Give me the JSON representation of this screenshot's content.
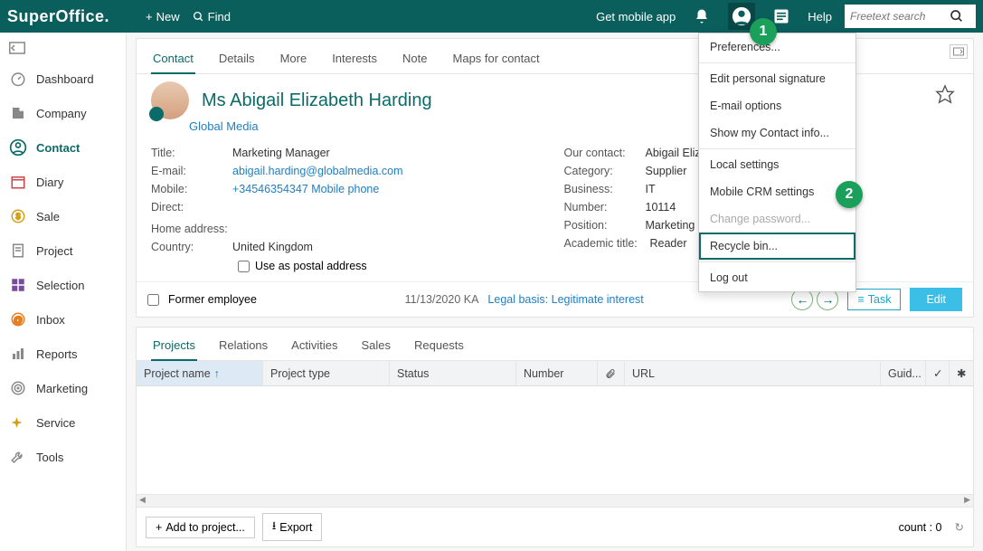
{
  "topbar": {
    "logo": "SuperOffice.",
    "new": "New",
    "find": "Find",
    "mobile": "Get mobile app",
    "help": "Help",
    "search_placeholder": "Freetext search"
  },
  "sidenav": [
    {
      "icon": "dashboard",
      "label": "Dashboard"
    },
    {
      "icon": "company",
      "label": "Company"
    },
    {
      "icon": "contact",
      "label": "Contact",
      "selected": true
    },
    {
      "icon": "diary",
      "label": "Diary"
    },
    {
      "icon": "sale",
      "label": "Sale"
    },
    {
      "icon": "project",
      "label": "Project"
    },
    {
      "icon": "selection",
      "label": "Selection"
    },
    {
      "icon": "inbox",
      "label": "Inbox"
    },
    {
      "icon": "reports",
      "label": "Reports"
    },
    {
      "icon": "marketing",
      "label": "Marketing"
    },
    {
      "icon": "service",
      "label": "Service"
    },
    {
      "icon": "tools",
      "label": "Tools"
    }
  ],
  "tabs": [
    "Contact",
    "Details",
    "More",
    "Interests",
    "Note",
    "Maps for contact"
  ],
  "contact": {
    "name": "Ms Abigail Elizabeth Harding",
    "company": "Global Media",
    "left": {
      "title_label": "Title:",
      "title": "Marketing Manager",
      "email_label": "E-mail:",
      "email": "abigail.harding@globalmedia.com",
      "mobile_label": "Mobile:",
      "mobile": "+34546354347 Mobile phone",
      "direct_label": "Direct:",
      "direct": "",
      "home_label": "Home address:",
      "home": "",
      "country_label": "Country:",
      "country": "United Kingdom",
      "postal_checkbox": "Use as postal address"
    },
    "right": {
      "our_label": "Our contact:",
      "our": "Abigail Elizabet",
      "cat_label": "Category:",
      "cat": "Supplier",
      "bus_label": "Business:",
      "bus": "IT",
      "num_label": "Number:",
      "num": "10114",
      "pos_label": "Position:",
      "pos": "Marketing",
      "acad_label": "Academic title:",
      "acad": "Reader"
    }
  },
  "statusbar": {
    "former": "Former employee",
    "date": "11/13/2020 KA",
    "legal_label": "Legal basis:",
    "legal_value": "Legitimate interest",
    "task": "Task",
    "edit": "Edit"
  },
  "subtabs": [
    "Projects",
    "Relations",
    "Activities",
    "Sales",
    "Requests"
  ],
  "columns": [
    "Project name",
    "Project type",
    "Status",
    "Number",
    "",
    "URL",
    "Guid...",
    "",
    ""
  ],
  "footer": {
    "add": "Add to project...",
    "export": "Export",
    "count": "count : 0"
  },
  "dropdown": [
    {
      "label": "Preferences...",
      "type": "item"
    },
    {
      "type": "sep"
    },
    {
      "label": "Edit personal signature",
      "type": "item"
    },
    {
      "label": "E-mail options",
      "type": "item"
    },
    {
      "label": "Show my Contact info...",
      "type": "item"
    },
    {
      "type": "sep"
    },
    {
      "label": "Local settings",
      "type": "item"
    },
    {
      "label": "Mobile CRM settings",
      "type": "item"
    },
    {
      "label": "Change password...",
      "type": "item",
      "disabled": true
    },
    {
      "label": "Recycle bin...",
      "type": "item",
      "highlighted": true
    },
    {
      "type": "sep"
    },
    {
      "label": "Log out",
      "type": "item"
    }
  ],
  "badges": {
    "1": "1",
    "2": "2"
  }
}
